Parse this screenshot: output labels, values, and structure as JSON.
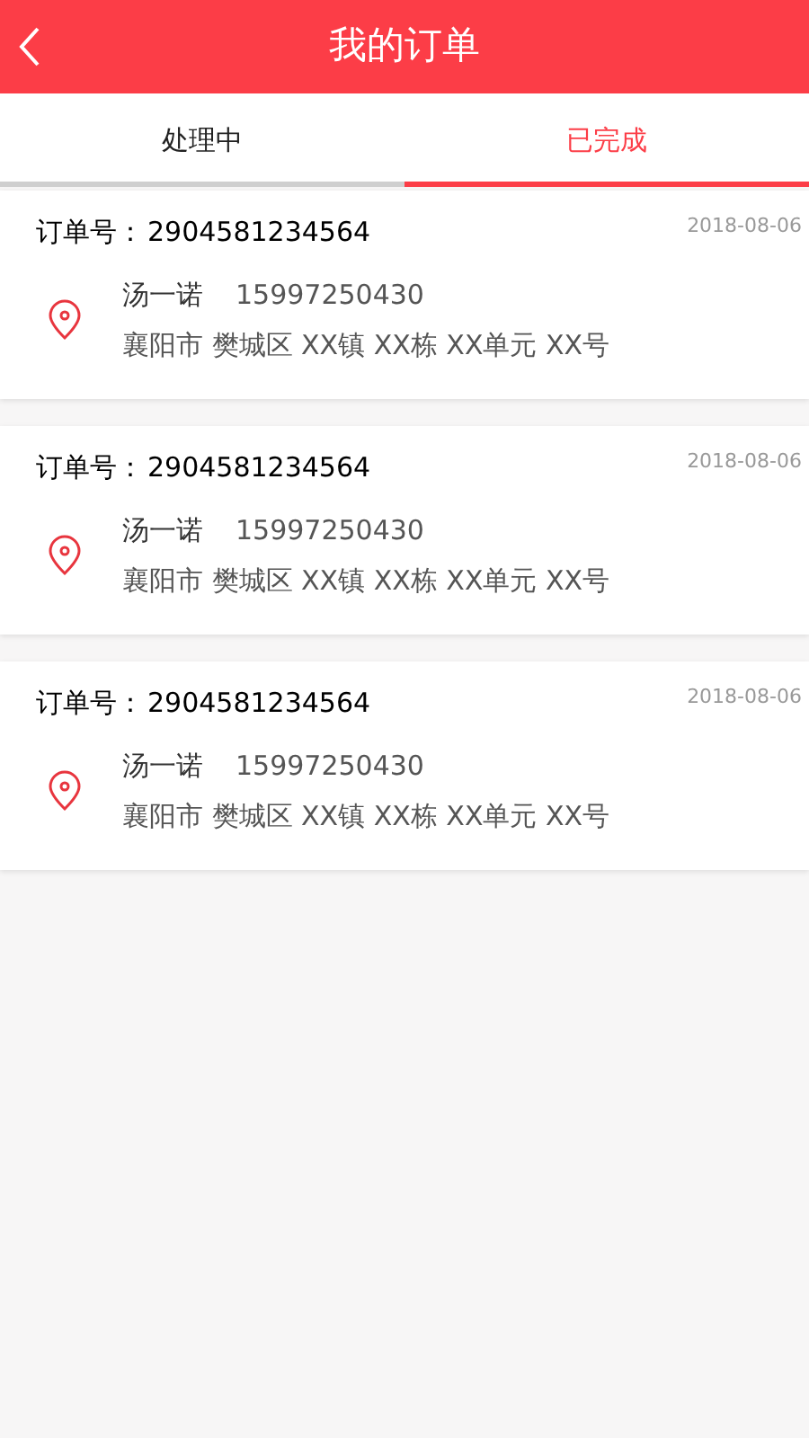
{
  "header": {
    "title": "我的订单"
  },
  "tabs": [
    {
      "label": "处理中",
      "selected": false
    },
    {
      "label": "已完成",
      "selected": true
    }
  ],
  "orders": [
    {
      "order_label": "订单号：",
      "order_number": "2904581234564",
      "date": "2018-08-06",
      "name": "汤一诺",
      "phone": "15997250430",
      "address": "襄阳市 樊城区 XX镇 XX栋 XX单元 XX号"
    },
    {
      "order_label": "订单号：",
      "order_number": "2904581234564",
      "date": "2018-08-06",
      "name": "汤一诺",
      "phone": "15997250430",
      "address": "襄阳市 樊城区 XX镇 XX栋 XX单元 XX号"
    },
    {
      "order_label": "订单号：",
      "order_number": "2904581234564",
      "date": "2018-08-06",
      "name": "汤一诺",
      "phone": "15997250430",
      "address": "襄阳市 樊城区 XX镇 XX栋 XX单元 XX号"
    }
  ]
}
